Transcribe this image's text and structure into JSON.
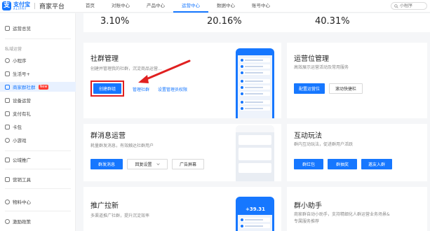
{
  "brand": {
    "logo_cn": "支付宝",
    "logo_en": "ALIPAY",
    "platform": "商家平台",
    "accent": "#1677ff"
  },
  "nav": {
    "items": [
      "首页",
      "对账中心",
      "产品中心",
      "运营中心",
      "数据中心",
      "账号中心"
    ],
    "active_index": 3
  },
  "search": {
    "placeholder": "小程序"
  },
  "sidebar": {
    "top_item": "运营总览",
    "group_label": "私域运营",
    "items": [
      {
        "label": "小程序"
      },
      {
        "label": "生活号+"
      },
      {
        "label": "商家群社群",
        "badge": "New",
        "active": true
      },
      {
        "label": "设备运营"
      },
      {
        "label": "支付有礼"
      },
      {
        "label": "卡包"
      },
      {
        "label": "小游戏"
      }
    ],
    "bottom_items": [
      "公域推广",
      "营销工具",
      "物料中心",
      "激励政策"
    ]
  },
  "stats": [
    "3.10%",
    "20.16%",
    "40.31%"
  ],
  "cards": {
    "community": {
      "title": "社群管理",
      "desc": "创建并管理我的社群，沉淀商品运营...",
      "create_btn": "创建群组",
      "manage_link": "管理社群",
      "admin_link": "设置管理员权限"
    },
    "slot": {
      "title": "运营位管理",
      "desc": "高效展示运营活动及常用服务",
      "primary_btn": "配置运营位",
      "secondary_btn": "滚动快捷栏"
    },
    "message": {
      "title": "群消息运营",
      "desc": "耗量群发消息，有效触达社群用户",
      "send_btn": "群发消息",
      "reply_btn": "回复设置",
      "ad_btn": "广告屏幕"
    },
    "interactive": {
      "title": "互动玩法",
      "desc": "群内互动玩法，促进群用户活跃",
      "btn1": "群红包",
      "btn2": "群抽奖",
      "btn3": "邀友入群"
    },
    "promotion": {
      "title": "推广拉新",
      "desc": "多渠道推广社群，提升沉淀效率",
      "phone_amount": "+39.31"
    },
    "assistant": {
      "title": "群小助手",
      "desc1": "商家群自动小助手，支持精细化人群运营业务场景&",
      "desc2": "专属服务推荐"
    }
  },
  "annotation_color": "#e02020"
}
